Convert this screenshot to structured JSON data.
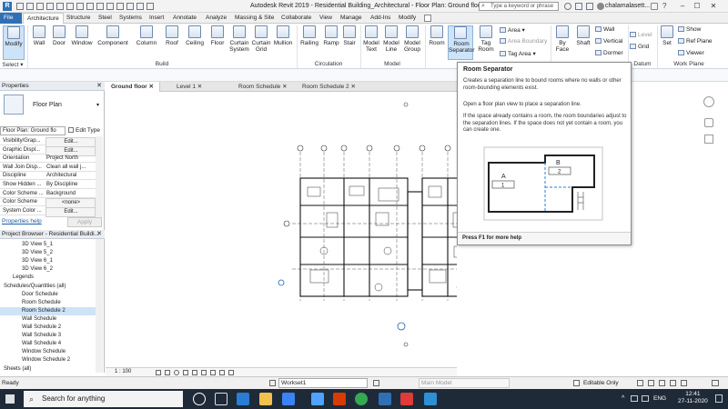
{
  "titlebar": {
    "app_title": "Autodesk Revit 2019 -  Residential Building_Architectural - Floor Plan: Ground floor",
    "search_placeholder": "Type a keyword or phrase",
    "username": "chalamalasett...",
    "minimize": "–",
    "maximize": "☐",
    "close": "✕"
  },
  "ribbon_tabs": [
    "File",
    "Architecture",
    "Structure",
    "Steel",
    "Systems",
    "Insert",
    "Annotate",
    "Analyze",
    "Massing & Site",
    "Collaborate",
    "View",
    "Manage",
    "Add-Ins",
    "Modify"
  ],
  "ribbon": {
    "modify": "Modify",
    "select": "Select ▾",
    "build_buttons": [
      "Wall",
      "Door",
      "Window",
      "Component",
      "Column",
      "Roof",
      "Ceiling",
      "Floor",
      "Curtain System",
      "Curtain Grid",
      "Mullion"
    ],
    "circulation_buttons": [
      "Railing",
      "Ramp",
      "Stair"
    ],
    "model_buttons": [
      "Model Text",
      "Model Line",
      "Model Group"
    ],
    "room_buttons": [
      "Room",
      "Room Separator",
      "Tag Room"
    ],
    "area_items": [
      "Area ▾",
      "Area Boundary",
      "Tag Area ▾"
    ],
    "opening_buttons": [
      "By Face",
      "Shaft"
    ],
    "opening_small": [
      "Wall",
      "Vertical",
      "Dormer"
    ],
    "datum_items": [
      "Level",
      "Grid"
    ],
    "workplane_set": "Set",
    "workplane_small": [
      "Show",
      "Ref Plane",
      "Viewer"
    ],
    "groups": [
      "Select",
      "Build",
      "Circulation",
      "Model",
      "Datum",
      "Work Plane"
    ]
  },
  "tooltip": {
    "title": "Room Separator",
    "p1": "Creates a separation line to bound rooms where no walls or other room-bounding elements exist.",
    "p2": "Open a floor plan view to place a separation line.",
    "p3": "If the space already contains a room, the room boundaries adjust to the separation lines. If the space does not yet contain a room, you can create one.",
    "fig_a": "A",
    "fig_b": "B",
    "fig_1": "1",
    "fig_2": "2",
    "footer": "Press F1 for more help"
  },
  "properties": {
    "header": "Properties",
    "type_name": "Floor Plan",
    "instance_select": "Floor Plan: Ground flo",
    "edit_type": "Edit Type",
    "rows": [
      {
        "k": "Visibility/Grap...",
        "v": "Edit...",
        "btn": true
      },
      {
        "k": "Graphic Displ...",
        "v": "Edit...",
        "btn": true
      },
      {
        "k": "Orientation",
        "v": "Project North",
        "btn": false
      },
      {
        "k": "Wall Join Disp...",
        "v": "Clean all wall j...",
        "btn": false
      },
      {
        "k": "Discipline",
        "v": "Architectural",
        "btn": false
      },
      {
        "k": "Show Hidden ...",
        "v": "By Discipline",
        "btn": false
      },
      {
        "k": "Color Scheme ...",
        "v": "Background",
        "btn": false
      },
      {
        "k": "Color Scheme",
        "v": "<none>",
        "btn": true
      },
      {
        "k": "System Color ...",
        "v": "Edit...",
        "btn": true
      }
    ],
    "help_link": "Properties help",
    "apply": "Apply"
  },
  "browser": {
    "header": "Project Browser - Residential Buildi...",
    "items": [
      {
        "t": "3D View 5_1",
        "indent": 2,
        "sel": false
      },
      {
        "t": "3D View 5_2",
        "indent": 2,
        "sel": false
      },
      {
        "t": "3D View 6_1",
        "indent": 2,
        "sel": false
      },
      {
        "t": "3D View 6_2",
        "indent": 2,
        "sel": false
      },
      {
        "t": "Legends",
        "indent": 1,
        "sel": false
      },
      {
        "t": "Schedules/Quantities (all)",
        "indent": 0,
        "sel": false
      },
      {
        "t": "Door Schedule",
        "indent": 2,
        "sel": false
      },
      {
        "t": "Room Schedule",
        "indent": 2,
        "sel": false
      },
      {
        "t": "Room Schedule 2",
        "indent": 2,
        "sel": true
      },
      {
        "t": "Wall Schedule",
        "indent": 2,
        "sel": false
      },
      {
        "t": "Wall Schedule 2",
        "indent": 2,
        "sel": false
      },
      {
        "t": "Wall Schedule 3",
        "indent": 2,
        "sel": false
      },
      {
        "t": "Wall Schedule 4",
        "indent": 2,
        "sel": false
      },
      {
        "t": "Window Schedule",
        "indent": 2,
        "sel": false
      },
      {
        "t": "Window Schedule 2",
        "indent": 2,
        "sel": false
      },
      {
        "t": "Sheets (all)",
        "indent": 0,
        "sel": false
      }
    ]
  },
  "view_tabs": [
    "Ground floor",
    "Level 1",
    "Room Schedule",
    "Room Schedule 2"
  ],
  "view_control": {
    "scale": "1 : 100"
  },
  "status": {
    "ready": "Ready",
    "workset": "Workset1",
    "model": "Main Model",
    "editable": "Editable Only"
  },
  "taskbar": {
    "search": "Search for anything",
    "lang": "ENG",
    "time": "12:41",
    "date": "27-11-2020"
  }
}
